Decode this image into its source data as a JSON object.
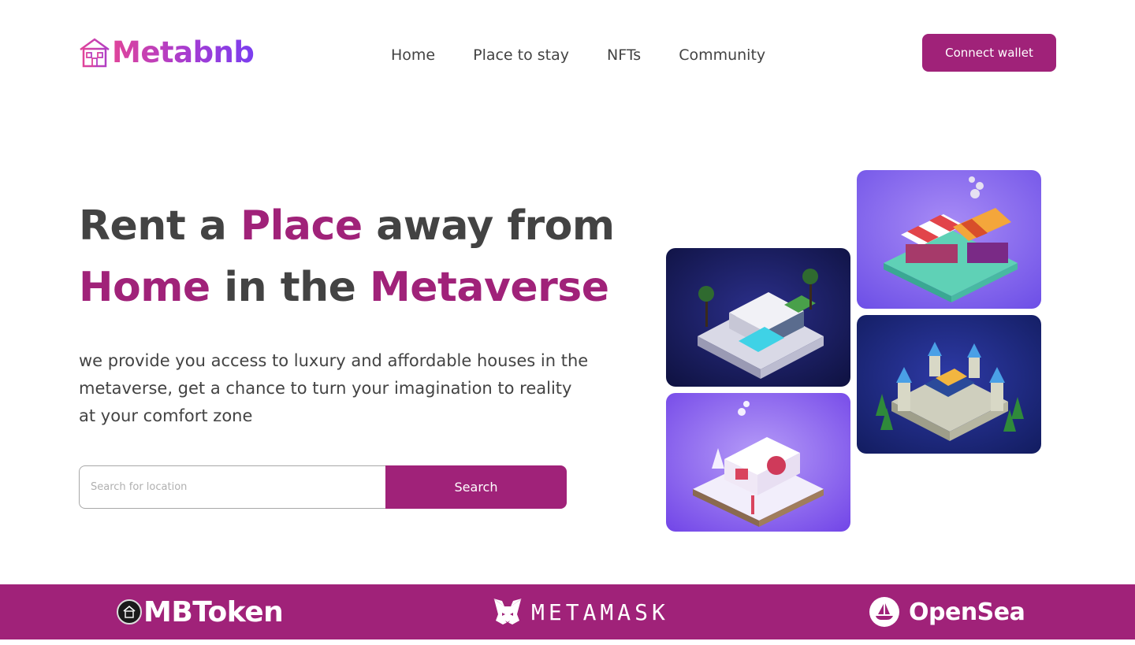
{
  "brand": {
    "name": "Metabnb",
    "icon": "house-logo-icon",
    "gradient": [
      "#e0449a",
      "#7a3ef0"
    ]
  },
  "nav": {
    "items": [
      {
        "label": "Home"
      },
      {
        "label": "Place to stay"
      },
      {
        "label": "NFTs"
      },
      {
        "label": "Community"
      }
    ],
    "connect_label": "Connect wallet"
  },
  "hero": {
    "title_parts": {
      "a": "Rent a ",
      "b": "Place",
      "c": " away from",
      "d": "Home",
      "e": " in the ",
      "f": "Metaverse"
    },
    "subtitle": "we provide you access to luxury and affordable houses in the metaverse, get a chance to turn your imagination to reality at your comfort zone"
  },
  "search": {
    "placeholder": "Search for location",
    "value": "",
    "button_label": "Search"
  },
  "gallery": [
    {
      "name": "modern-villa-image"
    },
    {
      "name": "market-stall-image"
    },
    {
      "name": "snow-cottage-image"
    },
    {
      "name": "castle-image"
    }
  ],
  "partners": [
    {
      "name": "MBToken",
      "icon": "mbtoken-coin-icon"
    },
    {
      "name": "METAMASK",
      "icon": "metamask-fox-icon"
    },
    {
      "name": "OpenSea",
      "icon": "opensea-boat-icon"
    }
  ],
  "colors": {
    "accent": "#a02279",
    "text": "#434343",
    "background": "#ffffff"
  }
}
